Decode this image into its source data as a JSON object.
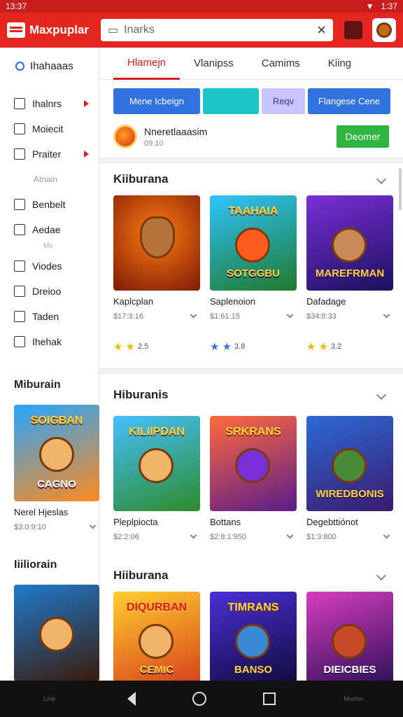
{
  "status": {
    "time": "13:37",
    "right_text": "1:37"
  },
  "header": {
    "app_title": "Maxpuplar",
    "search_placeholder": "Inarks"
  },
  "sidebar": {
    "head": "Ihahaaas",
    "items": [
      {
        "label": "Ihalnrs",
        "arrow": true
      },
      {
        "label": "Moiecit",
        "arrow": false
      },
      {
        "label": "Praiter",
        "arrow": true
      }
    ],
    "sub": "Atnain",
    "items2": [
      {
        "label": "Benbelt"
      },
      {
        "label": "Aedae"
      }
    ],
    "small": "Ms",
    "items3": [
      {
        "label": "Viodes"
      },
      {
        "label": "Dreioo"
      },
      {
        "label": "Taden"
      },
      {
        "label": "Ihehak"
      }
    ]
  },
  "tabs": [
    {
      "label": "Hlamejn"
    },
    {
      "label": "Vlanipss"
    },
    {
      "label": "Camims"
    },
    {
      "label": "Kiing"
    }
  ],
  "buttons": [
    {
      "label": "Mene Icbeign",
      "bg": "#2f72e0",
      "fg": "#ffffff"
    },
    {
      "label": "",
      "bg": "#1fc4c6",
      "fg": "#ffffff"
    },
    {
      "label": "Reqv",
      "bg": "#c9c4ff",
      "fg": "#4a2fa8"
    },
    {
      "label": "Flangese Cene",
      "bg": "#2f72e0",
      "fg": "#ffffff"
    }
  ],
  "promo": {
    "title": "Nneretlaaasim",
    "sub": "09.10",
    "button": "Deomer"
  },
  "sections": [
    {
      "title": "Kiiburana",
      "cards": [
        {
          "name": "Kaplcplan",
          "price": "$17:3:16",
          "stars": "2",
          "rating": "2.5",
          "art_top": "",
          "art_bottom": "",
          "c1": "#ff7a12",
          "c2": "#7d1a06"
        },
        {
          "name": "Saplenoion",
          "price": "$1:61:15",
          "stars": "2",
          "rating": "3.8",
          "art_top": "TAAHAIA",
          "art_bottom": "SOTGGBU",
          "c1": "#2fc3ff",
          "c2": "#1f7a2a"
        },
        {
          "name": "Dafadage",
          "price": "$34:8:33",
          "stars": "2",
          "rating": "3.2",
          "art_top": "",
          "art_bottom": "MAREFRMAN",
          "c1": "#7a2fd6",
          "c2": "#1b1060"
        }
      ]
    },
    {
      "title": "Hiburanis",
      "cards": [
        {
          "name": "Pleplpiocta",
          "price": "$2:2:06",
          "art_top": "KILIIPDAN",
          "art_bottom": "",
          "c1": "#44c0ff",
          "c2": "#2e8b2a"
        },
        {
          "name": "Bottans",
          "price": "$2:8:1:950",
          "art_top": "SRKRANS",
          "art_bottom": "",
          "c1": "#ff6a3d",
          "c2": "#5a1c8a"
        },
        {
          "name": "Degebttiónot",
          "price": "$1:3:800",
          "art_top": "",
          "art_bottom": "WIREDBONIS",
          "c1": "#2c6ad6",
          "c2": "#3a1a6e"
        }
      ]
    },
    {
      "title": "Hiiburana",
      "cards": [
        {
          "art_top": "DIQURBAN",
          "art_bottom": "CEMIC",
          "c1": "#ffcf2f",
          "c2": "#d63d1a"
        },
        {
          "art_top": "TIMRANS",
          "art_bottom": "BANSO",
          "c1": "#4a2fd6",
          "c2": "#0f0a3a"
        },
        {
          "art_top": "",
          "art_bottom": "DIEICBIES",
          "c1": "#d63dc0",
          "c2": "#2b0f55"
        }
      ]
    }
  ],
  "left_sections": [
    {
      "title": "Miburain",
      "card": {
        "name": "Nerel Hjeslas",
        "price": "$3:0:9:10",
        "art_top": "SOIGBAN",
        "art_bottom": "CAGNO",
        "c1": "#26a6ff",
        "c2": "#ff8a1d"
      }
    },
    {
      "title": "Iiiliorain",
      "card": {
        "art_top": "",
        "art_bottom": "",
        "c1": "#1f7acc",
        "c2": "#3b1a0a"
      }
    }
  ],
  "navbar": {
    "left": "Line",
    "right": "Murinn"
  }
}
